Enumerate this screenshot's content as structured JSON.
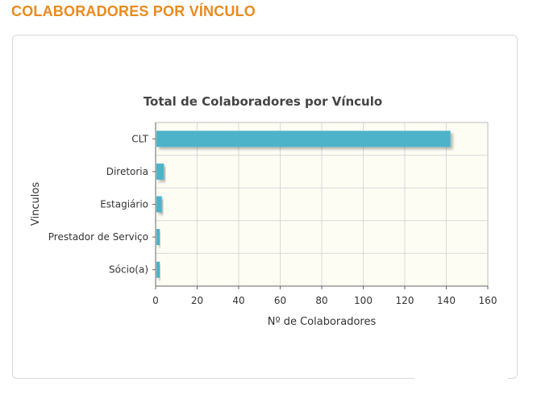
{
  "page": {
    "section_title": "COLABORADORES POR VÍNCULO"
  },
  "colors": {
    "accent": "#e98a1e",
    "bar": "#4db3c9",
    "plot_background": "#fefdf4",
    "grid": "#d8d8d8",
    "text": "#333333"
  },
  "chart_data": {
    "type": "bar",
    "orientation": "horizontal",
    "title": "Total de Colaboradores por Vínculo",
    "xlabel": "Nº de Colaboradores",
    "ylabel": "Vinculos",
    "categories": [
      "CLT",
      "Diretoria",
      "Estagiário",
      "Prestador de Serviço",
      "Sócio(a)"
    ],
    "values": [
      142,
      4,
      3,
      2,
      2
    ],
    "xlim": [
      0,
      160
    ],
    "xticks": [
      0,
      20,
      40,
      60,
      80,
      100,
      120,
      140,
      160
    ],
    "grid": true,
    "legend": false
  }
}
